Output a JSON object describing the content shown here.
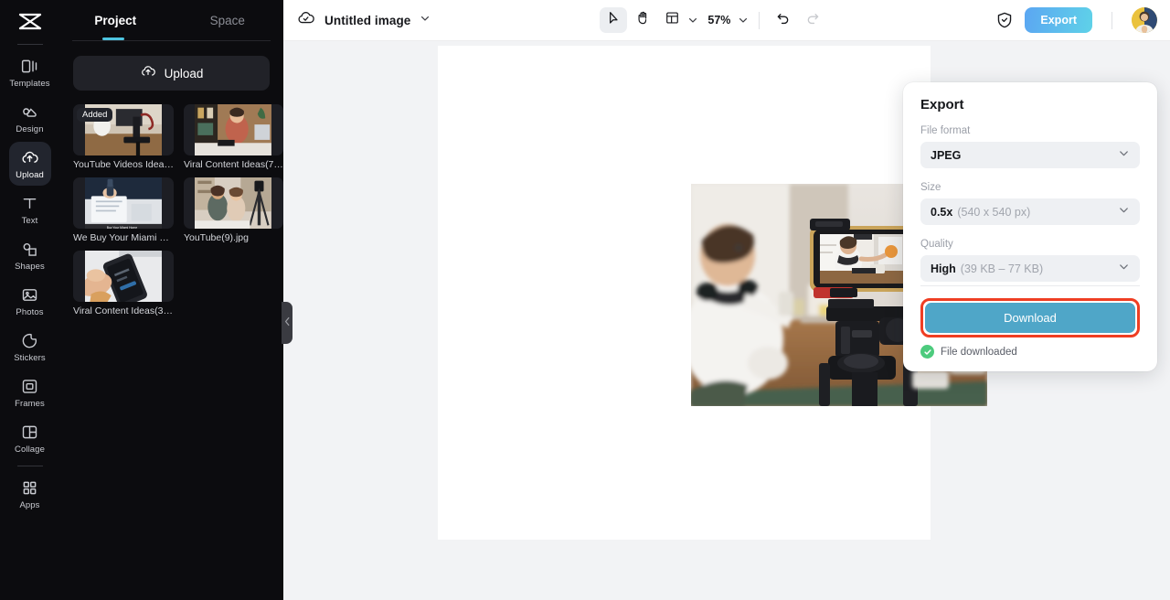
{
  "rail": {
    "logo_icon": "capcut-logo-icon",
    "items": [
      {
        "label": "Templates",
        "icon": "templates-icon",
        "active": false
      },
      {
        "label": "Design",
        "icon": "design-icon",
        "active": false
      },
      {
        "label": "Upload",
        "icon": "upload-cloud-icon",
        "active": true
      },
      {
        "label": "Text",
        "icon": "text-icon",
        "active": false
      },
      {
        "label": "Shapes",
        "icon": "shapes-icon",
        "active": false
      },
      {
        "label": "Photos",
        "icon": "photos-icon",
        "active": false
      },
      {
        "label": "Stickers",
        "icon": "stickers-icon",
        "active": false
      },
      {
        "label": "Frames",
        "icon": "frames-icon",
        "active": false
      },
      {
        "label": "Collage",
        "icon": "collage-icon",
        "active": false
      },
      {
        "label": "Apps",
        "icon": "apps-grid-icon",
        "active": false
      }
    ]
  },
  "panel": {
    "tabs": [
      {
        "label": "Project",
        "active": true
      },
      {
        "label": "Space",
        "active": false
      }
    ],
    "active_tab_color": "#4ec5e0",
    "upload_button": {
      "label": "Upload",
      "icon": "upload-cloud-icon"
    },
    "assets": [
      {
        "caption": "YouTube Videos Idea…",
        "badge": "Added"
      },
      {
        "caption": "Viral Content Ideas(7…",
        "badge": ""
      },
      {
        "caption": "We Buy Your Miami …",
        "badge": ""
      },
      {
        "caption": "YouTube(9).jpg",
        "badge": ""
      },
      {
        "caption": "Viral Content Ideas(3…",
        "badge": ""
      }
    ],
    "collapse_icon": "chevron-left-icon"
  },
  "topbar": {
    "cloud_icon": "cloud-saved-icon",
    "doc_title": "Untitled image",
    "title_caret_icon": "chevron-down-icon",
    "tools": [
      {
        "icon": "cursor-select-icon",
        "selected": true
      },
      {
        "icon": "hand-pan-icon",
        "selected": false
      },
      {
        "icon": "layout-grid-icon",
        "selected": false
      }
    ],
    "layout_caret_icon": "chevron-down-icon",
    "zoom": "57%",
    "zoom_caret_icon": "chevron-down-icon",
    "undo_icon": "undo-icon",
    "redo_icon": "redo-icon",
    "shield_icon": "shield-check-icon",
    "export_label": "Export",
    "export_gradient_from": "#5ba6f2",
    "export_gradient_to": "#5fd2e8",
    "avatar_icon": "user-avatar"
  },
  "canvas": {
    "background": "#f2f3f5",
    "page_background": "#ffffff",
    "artwork_alt": "vlogger filming himself with smartphone on tripod"
  },
  "export_popover": {
    "title": "Export",
    "file_format": {
      "label": "File format",
      "value": "JPEG",
      "caret_icon": "chevron-down-icon"
    },
    "size": {
      "label": "Size",
      "value": "0.5x",
      "detail": "(540 x 540 px)",
      "caret_icon": "chevron-down-icon"
    },
    "quality": {
      "label": "Quality",
      "value": "High",
      "detail": "(39 KB – 77 KB)",
      "caret_icon": "chevron-down-icon"
    },
    "download_label": "Download",
    "download_color": "#4fa6c8",
    "highlight_color": "#ef3e23",
    "status": {
      "icon": "check-circle-icon",
      "text": "File downloaded",
      "color": "#4ccb7d"
    }
  }
}
